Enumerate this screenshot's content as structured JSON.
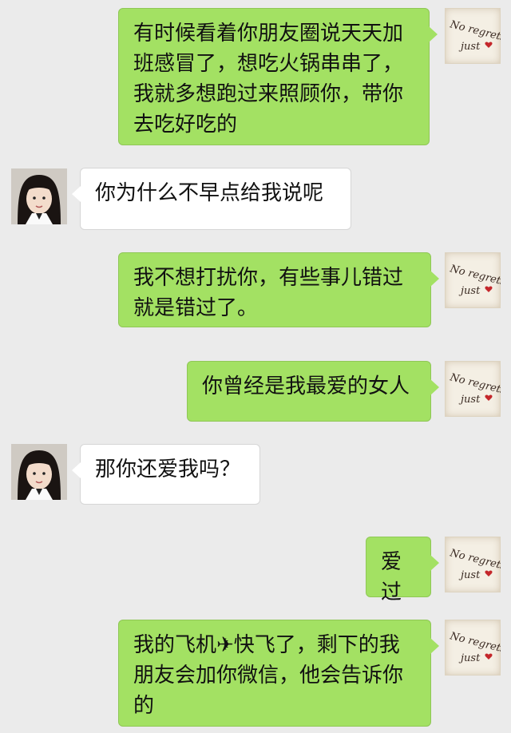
{
  "conversation": {
    "messages": [
      {
        "side": "out",
        "text": "有时候看着你朋友圈说天天加班感冒了，想吃火锅串串了，我就多想跑过来照顾你，带你去吃好吃的",
        "avatar": "note-avatar"
      },
      {
        "side": "in",
        "text": "你为什么不早点给我说呢",
        "avatar": "girl-avatar"
      },
      {
        "side": "out",
        "text": "我不想打扰你，有些事儿错过就是错过了。",
        "avatar": "note-avatar"
      },
      {
        "side": "out",
        "text": "你曾经是我最爱的女人",
        "avatar": "note-avatar"
      },
      {
        "side": "in",
        "text": "那你还爱我吗？",
        "avatar": "girl-avatar"
      },
      {
        "side": "out",
        "text": "爱过",
        "avatar": "note-avatar"
      },
      {
        "side": "out",
        "text": "我的飞机✈快飞了，剩下的我朋友会加你微信，他会告诉你的",
        "avatar": "note-avatar"
      }
    ],
    "note_avatar_text": [
      "No regrets",
      "just"
    ]
  },
  "colors": {
    "background": "#ebebeb",
    "outgoing_bubble": "#a3e163",
    "incoming_bubble": "#ffffff"
  }
}
